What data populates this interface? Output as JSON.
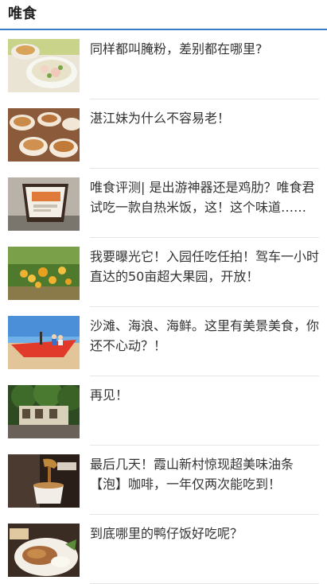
{
  "header": {
    "title": "唯食"
  },
  "articles": [
    {
      "title": "同样都叫腌粉，差别都在哪里?",
      "thumb": "noodle-soup-image"
    },
    {
      "title": "湛江妹为什么不容易老！",
      "thumb": "stew-cups-image"
    },
    {
      "title": "唯食评测| 是出游神器还是鸡肋？唯食君试吃一款自热米饭，这！这个味道……",
      "thumb": "self-heating-rice-image"
    },
    {
      "title": "我要曝光它！入园任吃任拍！驾车一小时直达的50亩超大果园，开放！",
      "thumb": "fruit-orchard-image"
    },
    {
      "title": "沙滩、海浪、海鲜。这里有美景美食，你还不心动？！",
      "thumb": "beach-boat-image"
    },
    {
      "title": "再见！",
      "thumb": "street-scene-image"
    },
    {
      "title": "最后几天！霞山新村惊现超美味油条【泡】咖啡，一年仅两次能吃到！",
      "thumb": "coffee-pour-image"
    },
    {
      "title": "到底哪里的鸭仔饭好吃呢？",
      "thumb": "duck-rice-image"
    }
  ]
}
